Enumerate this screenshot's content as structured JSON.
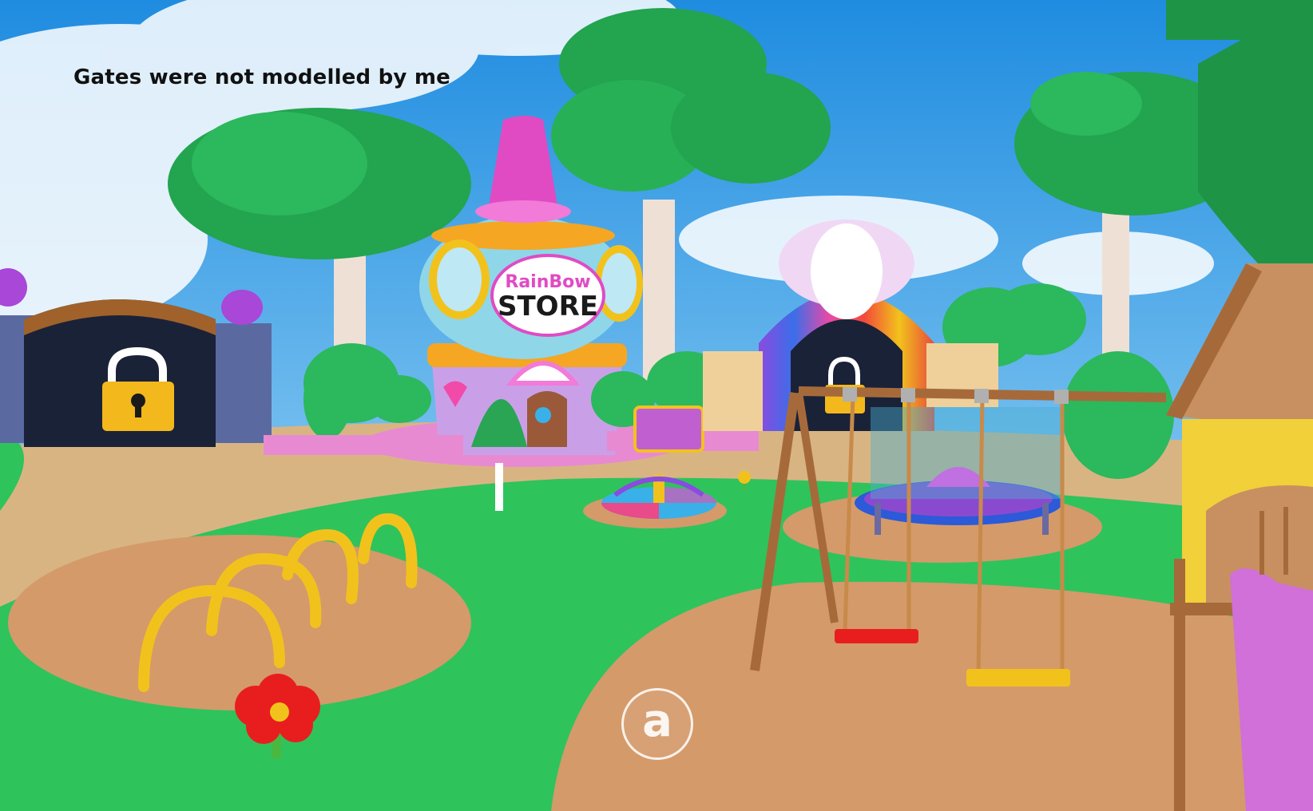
{
  "overlay": {
    "caption": "Gates were not modelled by me"
  },
  "store": {
    "sign_top": "RainBow",
    "sign_bottom": "STORE"
  },
  "controls": {
    "action_button_label": "a",
    "action_icon": "jump-action-icon"
  },
  "colors": {
    "sky": "#3aa0e8",
    "grass": "#2fc35c",
    "sand": "#d9b483",
    "tree_leaf": "#23a44f",
    "store_pink": "#e04bc4",
    "lock_yellow": "#f2b81c"
  }
}
